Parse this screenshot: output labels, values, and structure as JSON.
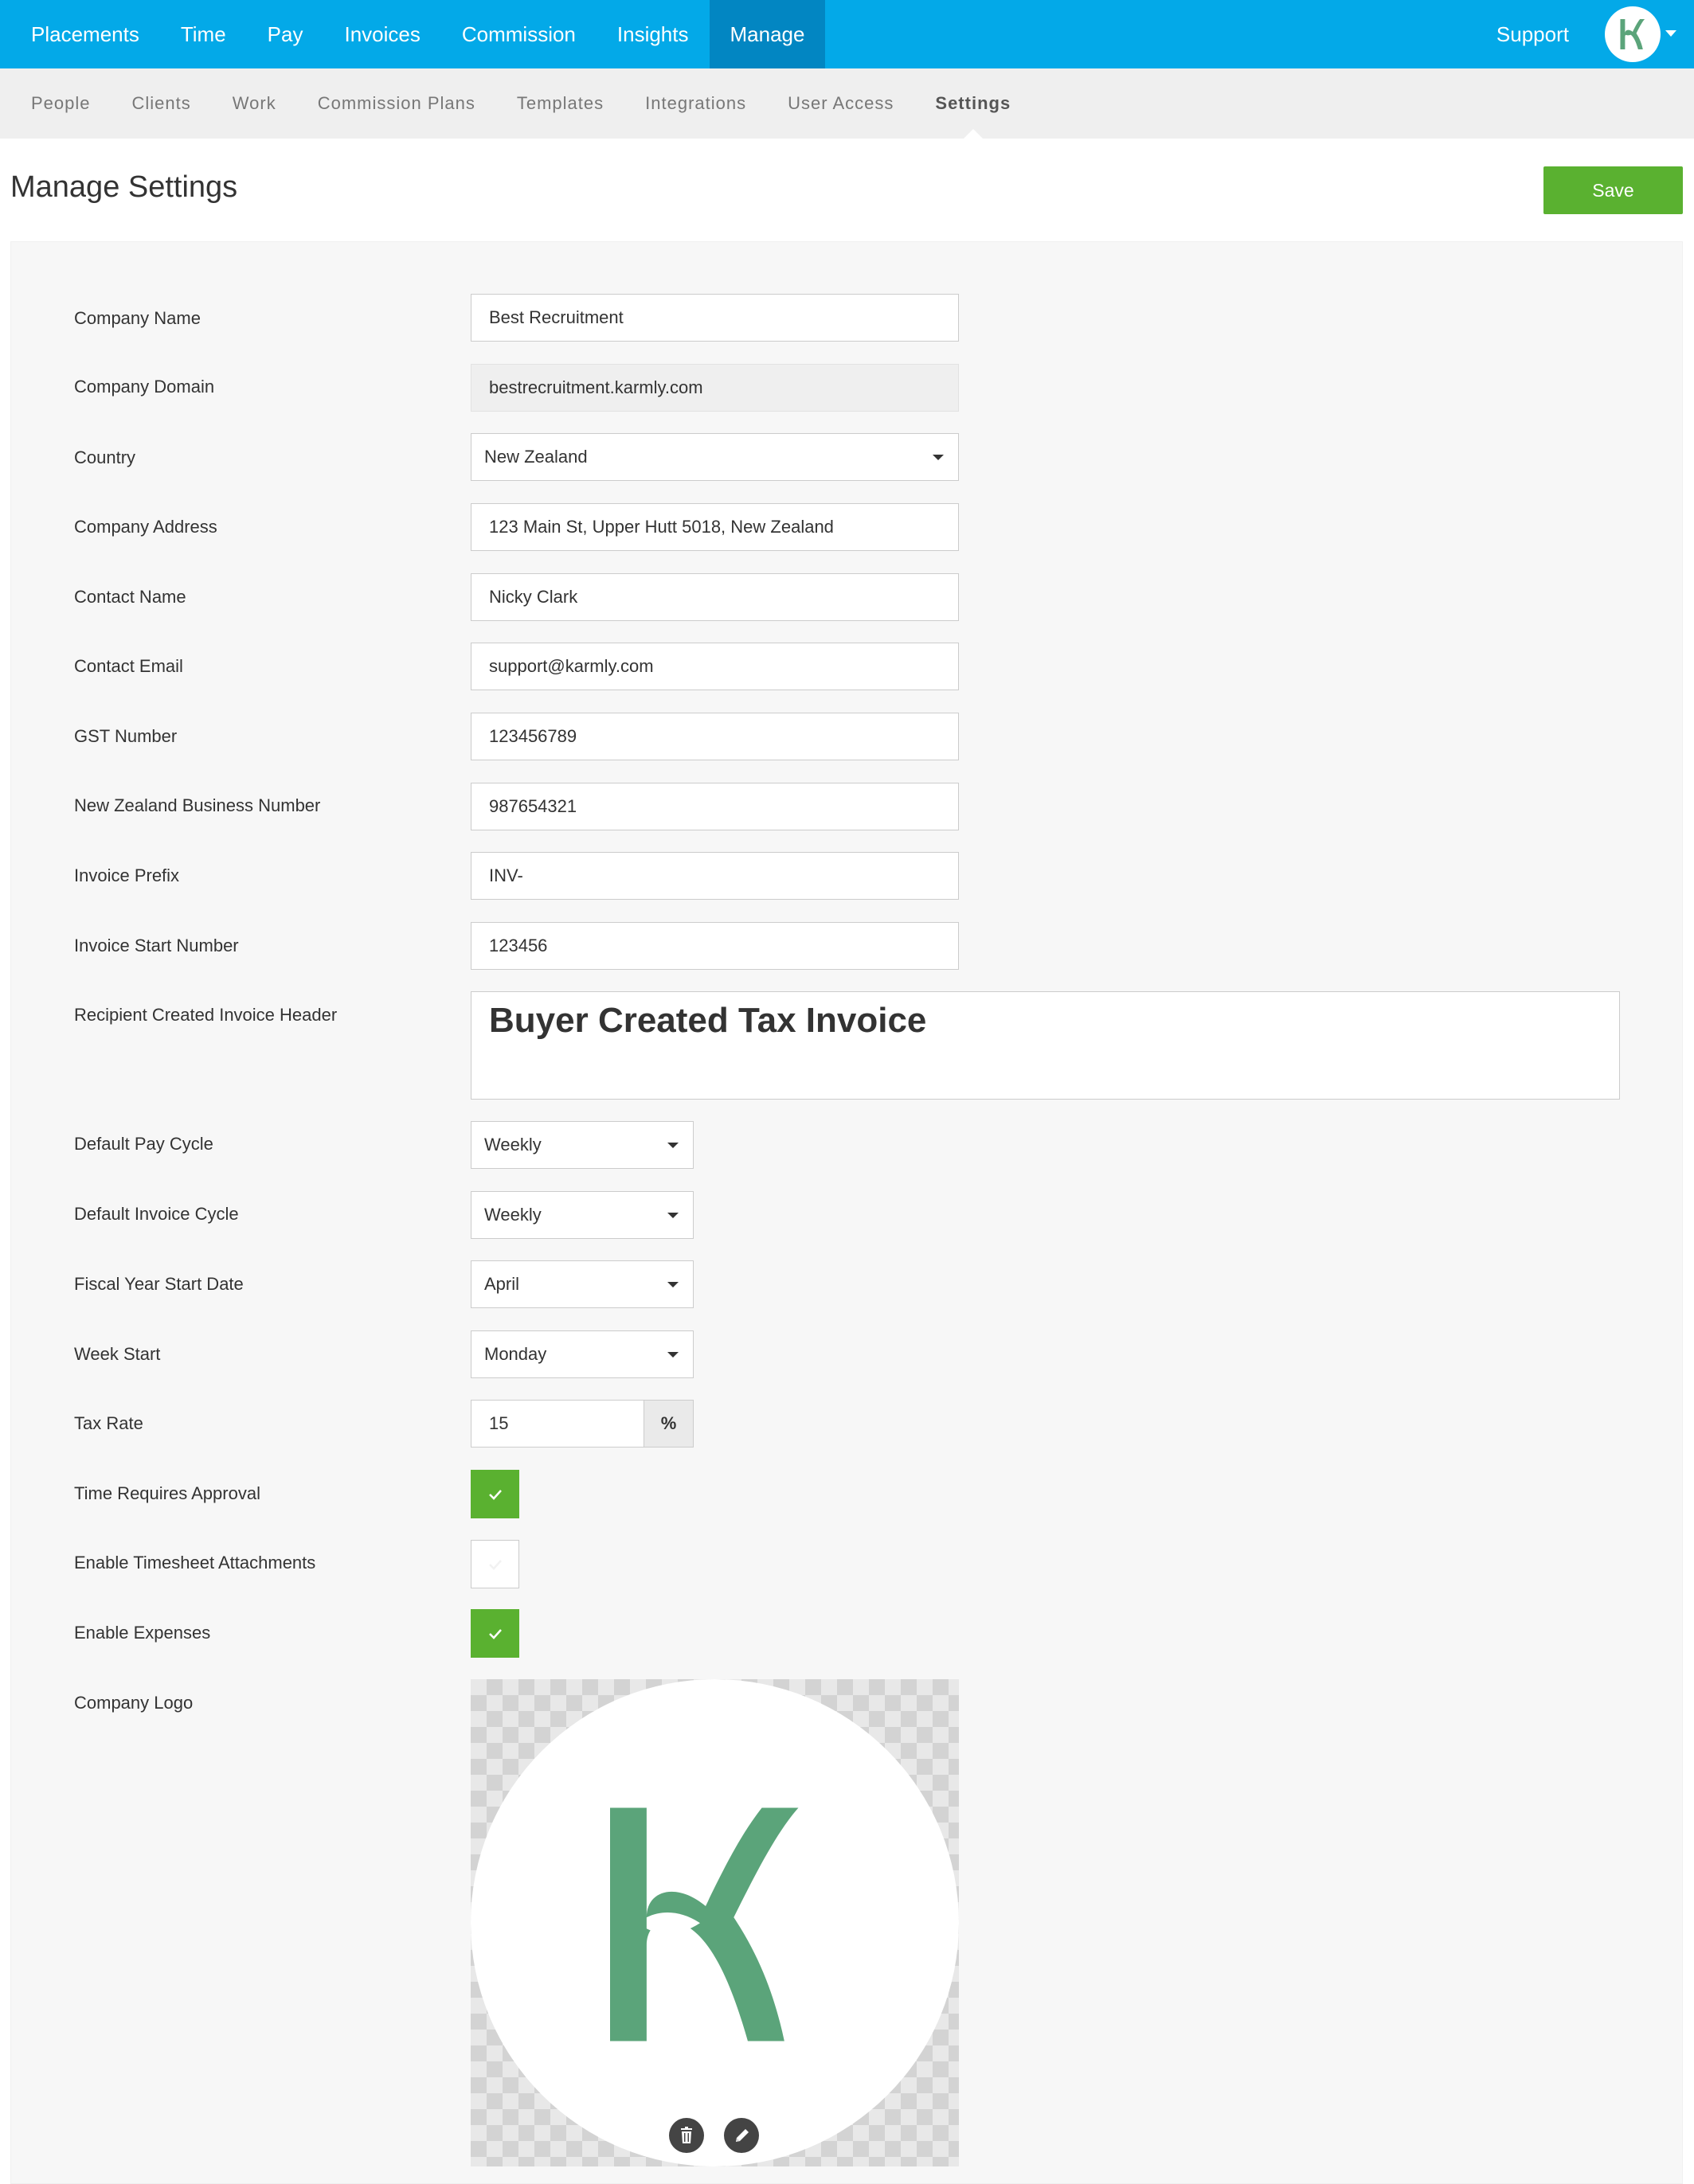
{
  "nav": {
    "items": [
      "Placements",
      "Time",
      "Pay",
      "Invoices",
      "Commission",
      "Insights",
      "Manage"
    ],
    "active": "Manage",
    "support_label": "Support",
    "avatar_icon": "karmly-logo-icon"
  },
  "subnav": {
    "items": [
      "People",
      "Clients",
      "Work",
      "Commission Plans",
      "Templates",
      "Integrations",
      "User Access",
      "Settings"
    ],
    "active": "Settings"
  },
  "header": {
    "title": "Manage Settings",
    "save_label": "Save"
  },
  "form": {
    "company_name": {
      "label": "Company Name",
      "value": "Best Recruitment"
    },
    "company_domain": {
      "label": "Company Domain",
      "value": "bestrecruitment.karmly.com"
    },
    "country": {
      "label": "Country",
      "value": "New Zealand"
    },
    "company_address": {
      "label": "Company Address",
      "value": "123 Main St, Upper Hutt 5018, New Zealand"
    },
    "contact_name": {
      "label": "Contact Name",
      "value": "Nicky Clark"
    },
    "contact_email": {
      "label": "Contact Email",
      "value": "support@karmly.com"
    },
    "gst_number": {
      "label": "GST Number",
      "value": "123456789"
    },
    "business_number": {
      "label": "New Zealand Business Number",
      "value": "987654321"
    },
    "invoice_prefix": {
      "label": "Invoice Prefix",
      "value": "INV-"
    },
    "invoice_start": {
      "label": "Invoice Start Number",
      "value": "123456"
    },
    "rcti_header": {
      "label": "Recipient Created Invoice Header",
      "value": "Buyer Created Tax Invoice"
    },
    "pay_cycle": {
      "label": "Default Pay Cycle",
      "value": "Weekly"
    },
    "invoice_cycle": {
      "label": "Default Invoice Cycle",
      "value": "Weekly"
    },
    "fiscal_year": {
      "label": "Fiscal Year Start Date",
      "value": "April"
    },
    "week_start": {
      "label": "Week Start",
      "value": "Monday"
    },
    "tax_rate": {
      "label": "Tax Rate",
      "value": "15",
      "unit": "%"
    },
    "time_approval": {
      "label": "Time Requires Approval",
      "checked": true
    },
    "timesheet_attachments": {
      "label": "Enable Timesheet Attachments",
      "checked": false
    },
    "expenses": {
      "label": "Enable Expenses",
      "checked": true
    },
    "company_logo": {
      "label": "Company Logo",
      "delete_icon": "trash-icon",
      "edit_icon": "pencil-icon"
    }
  },
  "colors": {
    "topbar": "#03a9e8",
    "topbar_active": "#0286c2",
    "save_green": "#5ab130",
    "logo_green": "#5ba47a"
  }
}
